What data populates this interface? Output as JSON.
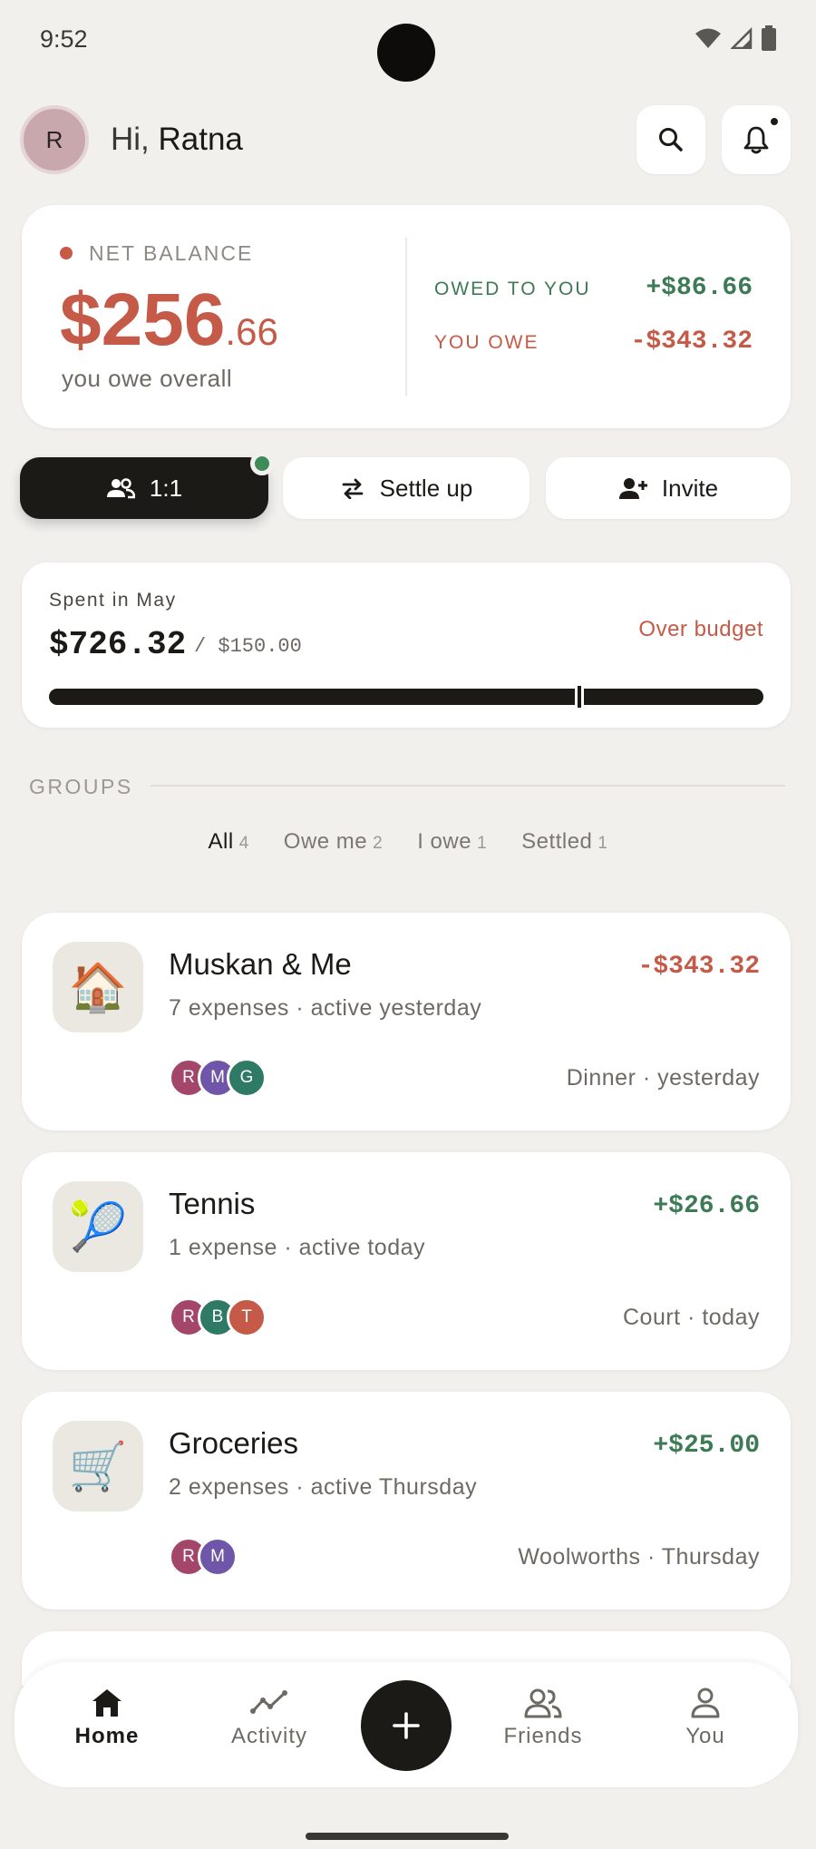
{
  "status": {
    "time": "9:52"
  },
  "header": {
    "avatar_initial": "R",
    "greeting_prefix": "Hi, ",
    "user_name": "Ratna"
  },
  "balance": {
    "label": "NET BALANCE",
    "amount_whole": "$256",
    "amount_cents": ".66",
    "caption": "you owe overall",
    "owed_to_you_label": "OWED TO YOU",
    "owed_to_you_value": "+$86.66",
    "you_owe_label": "YOU OWE",
    "you_owe_value": "-$343.32"
  },
  "actions": {
    "one_on_one": "1:1",
    "settle_up": "Settle up",
    "invite": "Invite"
  },
  "spending": {
    "label": "Spent in May",
    "amount": "$726.32",
    "budget": "/ $150.00",
    "status": "Over budget",
    "budget_marker_fraction": 0.21
  },
  "groups_section": {
    "label": "GROUPS",
    "filters": [
      {
        "label": "All",
        "count": "4"
      },
      {
        "label": "Owe me",
        "count": "2"
      },
      {
        "label": "I owe",
        "count": "1"
      },
      {
        "label": "Settled",
        "count": "1"
      }
    ]
  },
  "groups": [
    {
      "icon": "🏠",
      "name": "Muskan & Me",
      "subtitle": "7 expenses · active yesterday",
      "amount": "-$343.32",
      "last": "Dinner · yesterday",
      "members": [
        {
          "initial": "R",
          "color": "#a3466a"
        },
        {
          "initial": "M",
          "color": "#7056a8"
        },
        {
          "initial": "G",
          "color": "#2e7a64"
        }
      ]
    },
    {
      "icon": "🎾",
      "name": "Tennis",
      "subtitle": "1 expense · active today",
      "amount": "+$26.66",
      "last": "Court · today",
      "members": [
        {
          "initial": "R",
          "color": "#a3466a"
        },
        {
          "initial": "B",
          "color": "#2e7a64"
        },
        {
          "initial": "T",
          "color": "#c45a47"
        }
      ]
    },
    {
      "icon": "🛒",
      "name": "Groceries",
      "subtitle": "2 expenses · active Thursday",
      "amount": "+$25.00",
      "last": "Woolworths · Thursday",
      "members": [
        {
          "initial": "R",
          "color": "#a3466a"
        },
        {
          "initial": "M",
          "color": "#7056a8"
        }
      ]
    }
  ],
  "nav": {
    "home": "Home",
    "activity": "Activity",
    "friends": "Friends",
    "you": "You"
  },
  "colors": {
    "accent_red": "#c45a47",
    "accent_green": "#3e7a55",
    "dark": "#1c1a17"
  }
}
